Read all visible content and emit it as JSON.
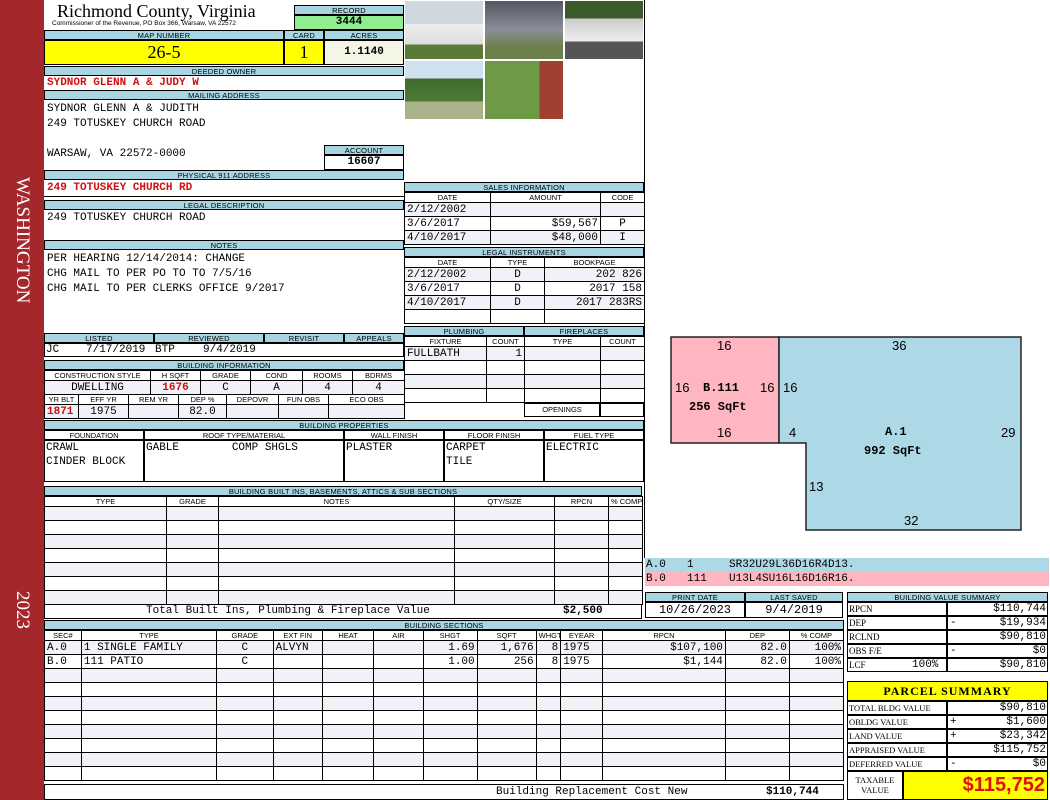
{
  "side": {
    "county": "WASHINGTON",
    "year": "2023"
  },
  "header": {
    "county_title": "Richmond County, Virginia",
    "subtitle": "Commissioner of the Revenue, PO Box 366, Warsaw, VA 22572",
    "record_label": "RECORD",
    "record": "3444",
    "map_label": "MAP NUMBER",
    "map_number": "26-5",
    "card_label": "CARD",
    "card": "1",
    "acres_label": "ACRES",
    "acres": "1.1140"
  },
  "owner": {
    "label": "DEEDED OWNER",
    "name": "SYDNOR GLENN A & JUDY W"
  },
  "mailing": {
    "label": "MAILING ADDRESS",
    "lines": [
      "SYDNOR GLENN A & JUDITH",
      "249 TOTUSKEY CHURCH ROAD",
      "WARSAW, VA 22572-0000"
    ],
    "account_label": "ACCOUNT",
    "account": "16607"
  },
  "physical": {
    "label": "PHYSICAL 911 ADDRESS",
    "address": "249 TOTUSKEY CHURCH RD"
  },
  "legal": {
    "label": "LEGAL DESCRIPTION",
    "text": "249 TOTUSKEY CHURCH ROAD"
  },
  "notes": {
    "label": "NOTES",
    "lines": [
      "PER HEARING 12/14/2014: CHANGE",
      "CHG MAIL TO PER PO TO TO 7/5/16",
      "CHG MAIL TO PER CLERKS OFFICE 9/2017"
    ]
  },
  "review": {
    "headers": [
      "LISTED",
      "REVIEWED",
      "REVISIT",
      "APPEALS"
    ],
    "listed_by": "JC",
    "listed_date": "7/17/2019",
    "reviewed_by": "BTP",
    "reviewed_date": "9/4/2019"
  },
  "building_info": {
    "title": "BUILDING INFORMATION",
    "headers1": [
      "CONSTRUCTION STYLE",
      "H SQFT",
      "GRADE",
      "COND",
      "ROOMS",
      "BDRMS"
    ],
    "values1": [
      "DWELLING",
      "1676",
      "C",
      "A",
      "4",
      "4"
    ],
    "headers2": [
      "YR BLT",
      "EFF YR",
      "REM YR",
      "DEP %",
      "DEPOVR",
      "FUN OBS",
      "ECO OBS"
    ],
    "values2": [
      "1871",
      "1975",
      "",
      "82.0",
      "",
      "",
      ""
    ]
  },
  "sales": {
    "title": "SALES INFORMATION",
    "columns": [
      "DATE",
      "AMOUNT",
      "CODE"
    ],
    "rows": [
      [
        "2/12/2002",
        "",
        ""
      ],
      [
        "3/6/2017",
        "$59,567",
        "P"
      ],
      [
        "4/10/2017",
        "$48,000",
        "I"
      ]
    ]
  },
  "legal_instruments": {
    "title": "LEGAL INSTRUMENTS",
    "columns": [
      "DATE",
      "TYPE",
      "BOOKPAGE"
    ],
    "rows": [
      [
        "2/12/2002",
        "D",
        "202 826"
      ],
      [
        "3/6/2017",
        "D",
        "2017 158"
      ],
      [
        "4/10/2017",
        "D",
        "2017 283RS"
      ],
      [
        "",
        "",
        ""
      ]
    ]
  },
  "plumbing": {
    "title": "PLUMBING",
    "columns": [
      "FIXTURE",
      "COUNT"
    ],
    "rows": [
      [
        "FULLBATH",
        "1"
      ],
      [
        "",
        ""
      ],
      [
        "",
        ""
      ],
      [
        "",
        ""
      ]
    ]
  },
  "fireplaces": {
    "title": "FIREPLACES",
    "columns": [
      "TYPE",
      "COUNT"
    ],
    "rows": [
      [
        "",
        ""
      ],
      [
        "",
        ""
      ],
      [
        "",
        ""
      ],
      [
        "",
        ""
      ]
    ],
    "openings_label": "OPENINGS"
  },
  "building_properties": {
    "title": "BUILDING PROPERTIES",
    "columns": [
      "FOUNDATION",
      "ROOF TYPE/MATERIAL",
      "WALL FINISH",
      "FLOOR FINISH",
      "FUEL TYPE"
    ],
    "values": [
      [
        "CRAWL",
        "CINDER BLOCK"
      ],
      [
        "GABLE        COMP SHGLS",
        ""
      ],
      [
        "PLASTER",
        ""
      ],
      [
        "CARPET",
        "TILE"
      ],
      [
        "ELECTRIC",
        ""
      ]
    ]
  },
  "built_ins": {
    "title": "BUILDING BUILT INS, BASEMENTS, ATTICS & SUB SECTIONS",
    "columns": [
      "TYPE",
      "GRADE",
      "NOTES",
      "QTY/SIZE",
      "RPCN",
      "% COMP"
    ],
    "total_label": "Total Built Ins, Plumbing & Fireplace Value",
    "total_value": "$2,500"
  },
  "dates": {
    "print_label": "PRINT DATE",
    "print_date": "10/26/2023",
    "saved_label": "LAST SAVED",
    "saved_date": "9/4/2019"
  },
  "sections": {
    "title": "BUILDING SECTIONS",
    "columns": [
      "SEC#",
      "TYPE",
      "GRADE",
      "EXT FIN",
      "HEAT",
      "AIR",
      "SHGT",
      "SQFT",
      "WHGT",
      "EYEAR",
      "RPCN",
      "DEP",
      "% COMP"
    ],
    "rows": [
      [
        "A.0",
        "1 SINGLE FAMILY",
        "C",
        "ALVYN",
        "",
        "",
        "1.69",
        "1,676",
        "8",
        "1975",
        "$107,100",
        "82.0",
        "100%"
      ],
      [
        "B.0",
        "111 PATIO",
        "C",
        "",
        "",
        "",
        "1.00",
        "256",
        "8",
        "1975",
        "$1,144",
        "82.0",
        "100%"
      ]
    ],
    "replacement_label": "Building Replacement Cost New",
    "replacement_value": "$110,744"
  },
  "sketch": {
    "b_label": "B.111",
    "b_area": "256 SqFt",
    "b_top": "16",
    "b_left": "16",
    "b_right": "16",
    "b_bottom": "16",
    "a_label": "A.1",
    "a_area": "992 SqFt",
    "a_top": "36",
    "a_left": "16",
    "a_notch": "4",
    "a_right": "29",
    "a_lower_left": "13",
    "a_bottom": "32",
    "codes": [
      {
        "sec": "A.0",
        "code": "1",
        "path": "SR32U29L36D16R4D13."
      },
      {
        "sec": "B.0",
        "code": "111",
        "path": "U13L4SU16L16D16R16."
      }
    ]
  },
  "value_summary": {
    "title": "BUILDING VALUE SUMMARY",
    "rows": [
      {
        "label": "RPCN",
        "pct": "",
        "sign": "",
        "value": "$110,744"
      },
      {
        "label": "DEP",
        "pct": "",
        "sign": "-",
        "value": "$19,934"
      },
      {
        "label": "RCLND",
        "pct": "",
        "sign": "",
        "value": "$90,810"
      },
      {
        "label": "OBS F/E",
        "pct": "",
        "sign": "-",
        "value": "$0"
      },
      {
        "label": "LCF",
        "pct": "100%",
        "sign": "",
        "value": "$90,810"
      }
    ]
  },
  "parcel": {
    "title": "PARCEL SUMMARY",
    "rows": [
      {
        "label": "TOTAL BLDG VALUE",
        "sign": "",
        "value": "$90,810"
      },
      {
        "label": "OBLDG VALUE",
        "sign": "+",
        "value": "$1,600"
      },
      {
        "label": "LAND VALUE",
        "sign": "+",
        "value": "$23,342"
      },
      {
        "label": "APPRAISED VALUE",
        "sign": "",
        "value": "$115,752"
      },
      {
        "label": "DEFERRED VALUE",
        "sign": "-",
        "value": "$0"
      }
    ],
    "taxable_label": "TAXABLE VALUE",
    "taxable_value": "$115,752"
  },
  "colors": {
    "header_blue": "#a9d5e3",
    "highlight_yellow": "#ffff00",
    "record_green": "#90ee90",
    "side_red": "#a3272b",
    "sketch_a": "#add8e6",
    "sketch_b": "#ffb6c1"
  }
}
